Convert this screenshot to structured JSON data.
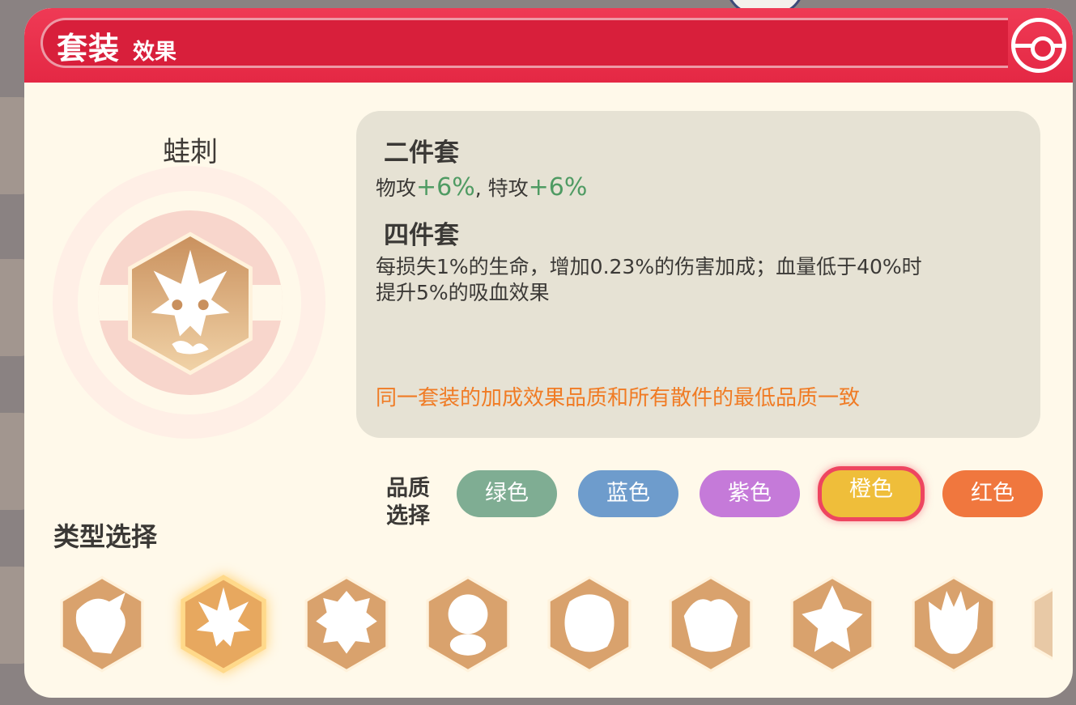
{
  "header": {
    "title_main": "套装",
    "title_sub": "效果",
    "close_icon": "pokeball-icon"
  },
  "set": {
    "name": "蛙刺",
    "icon": "greninja-emblem-icon"
  },
  "info": {
    "two_piece_title": "二件套",
    "two_piece_a_label": "物攻",
    "two_piece_a_value": "+6%",
    "two_piece_sep": ", 特攻",
    "two_piece_b_value": "+6%",
    "four_piece_title": "四件套",
    "four_piece_line1": "每损失1%的生命，增加0.23%的伤害加成；血量低于40%时",
    "four_piece_line2": "提升5%的吸血效果",
    "note": "同一套装的加成效果品质和所有散件的最低品质一致"
  },
  "quality": {
    "label_line1": "品质",
    "label_line2": "选择",
    "options": [
      {
        "label": "绿色",
        "color": "#7fad93"
      },
      {
        "label": "蓝色",
        "color": "#6e9ccc"
      },
      {
        "label": "紫色",
        "color": "#c57ad9"
      },
      {
        "label": "橙色",
        "color": "#efbe3a",
        "selected": true
      },
      {
        "label": "红色",
        "color": "#f0773e"
      }
    ]
  },
  "types": {
    "title": "类型选择",
    "items": [
      {
        "icon": "dragon-emblem-icon"
      },
      {
        "icon": "greninja-emblem-icon",
        "selected": true
      },
      {
        "icon": "lion-emblem-icon"
      },
      {
        "icon": "squirtle-emblem-icon"
      },
      {
        "icon": "golem-emblem-icon"
      },
      {
        "icon": "bull-emblem-icon"
      },
      {
        "icon": "bird-emblem-icon"
      },
      {
        "icon": "ghost-emblem-icon"
      },
      {
        "icon": "partial-emblem-icon"
      }
    ]
  },
  "colors": {
    "header_red": "#e42844",
    "panel_bg": "#fff9ea",
    "accent_green": "#4f9b63",
    "note_orange": "#f07b24",
    "hex_gold": "#d9a26d"
  }
}
